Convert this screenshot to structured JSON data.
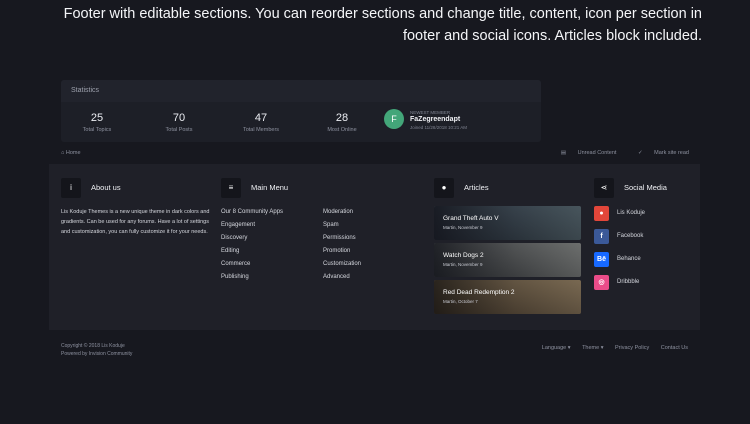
{
  "hero": {
    "line1": "Footer with editable sections. You can reorder sections and change title, content, icon per section in",
    "line2": "footer and social icons. Articles block included."
  },
  "statistics": {
    "title": "Statistics",
    "items": [
      {
        "value": "25",
        "label": "Total Topics"
      },
      {
        "value": "70",
        "label": "Total Posts"
      },
      {
        "value": "47",
        "label": "Total Members"
      },
      {
        "value": "28",
        "label": "Most Online"
      }
    ],
    "newest": {
      "label": "NEWEST MEMBER",
      "avatar_letter": "F",
      "name": "FaZegreendapt",
      "joined": "Joined 11/28/2018 10:21 AM",
      "avatar_color": "#43a679"
    }
  },
  "breadcrumb": {
    "home_icon": "home-icon",
    "home": "Home",
    "unread": "Unread Content",
    "mark_read": "Mark site read"
  },
  "footer": {
    "about": {
      "icon": "info-icon",
      "title": "About us",
      "text": "Lis Koduje Themes is a new unique theme in dark colors and gradients. Can be used for any forums. Have a lot of settings and customization, you can fully customize it for your needs."
    },
    "menu": {
      "icon": "menu-icon",
      "title": "Main Menu",
      "col1": [
        "Our 8 Community Apps",
        "Engagement",
        "Discovery",
        "Editing",
        "Commerce",
        "Publishing"
      ],
      "col2": [
        "Moderation",
        "Spam",
        "Permissions",
        "Promotion",
        "Customization",
        "Advanced"
      ]
    },
    "articles": {
      "icon": "comments-icon",
      "title": "Articles",
      "items": [
        {
          "title": "Grand Theft Auto V",
          "meta": "Martin, November 9"
        },
        {
          "title": "Watch Dogs 2",
          "meta": "Martin, November 9"
        },
        {
          "title": "Red Dead Redemption 2",
          "meta": "Martin, October 7"
        }
      ]
    },
    "social": {
      "icon": "share-icon",
      "title": "Social Media",
      "items": [
        {
          "label": "Lis Koduje",
          "icon": "lis-koduje-icon",
          "glyph": "●",
          "color": "#e2463a"
        },
        {
          "label": "Facebook",
          "icon": "facebook-icon",
          "glyph": "f",
          "color": "#3b5998"
        },
        {
          "label": "Behance",
          "icon": "behance-icon",
          "glyph": "Bē",
          "color": "#1769ff"
        },
        {
          "label": "Dribbble",
          "icon": "dribbble-icon",
          "glyph": "◎",
          "color": "#ea4c89"
        }
      ]
    }
  },
  "bottom": {
    "copyright": "Copyright © 2018 Lis Koduje",
    "powered": "Powered by Invision Community",
    "links": [
      "Language ▾",
      "Theme ▾",
      "Privacy Policy",
      "Contact Us"
    ]
  }
}
